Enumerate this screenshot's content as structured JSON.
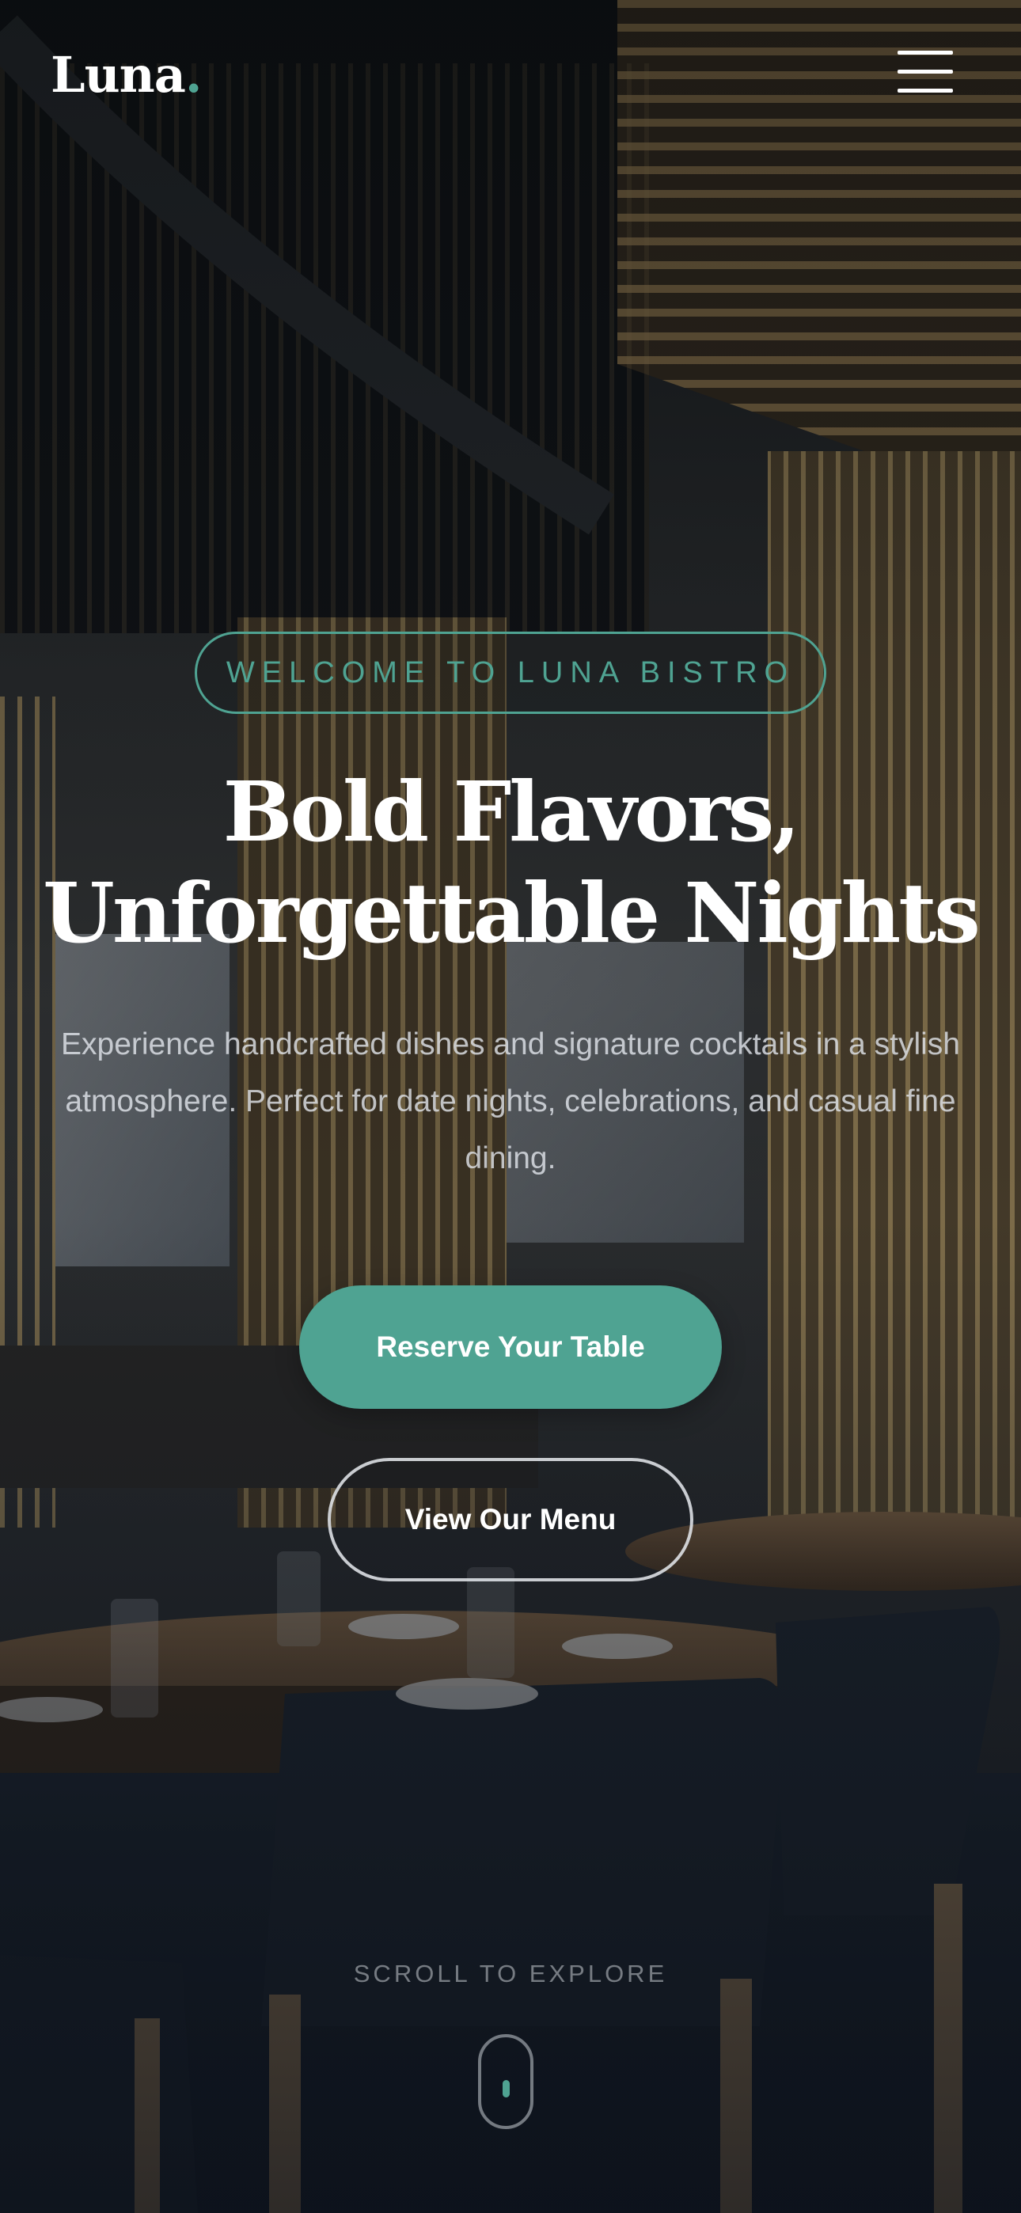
{
  "header": {
    "logo_text": "Luna",
    "logo_dot": ".",
    "menu_icon": "hamburger-icon"
  },
  "hero": {
    "badge": "WELCOME TO LUNA BISTRO",
    "headline_line1": "Bold Flavors,",
    "headline_line2": "Unforgettable Nights",
    "subtext": "Experience handcrafted dishes and signature cocktails in a stylish atmosphere. Perfect for date nights, celebrations, and casual fine dining.",
    "primary_button": "Reserve Your Table",
    "secondary_button": "View Our Menu",
    "scroll_hint": "SCROLL TO EXPLORE",
    "scroll_icon": "mouse-scroll-icon"
  },
  "colors": {
    "accent": "#4fa392",
    "text": "#ffffff",
    "overlay": "#0b0f14"
  }
}
